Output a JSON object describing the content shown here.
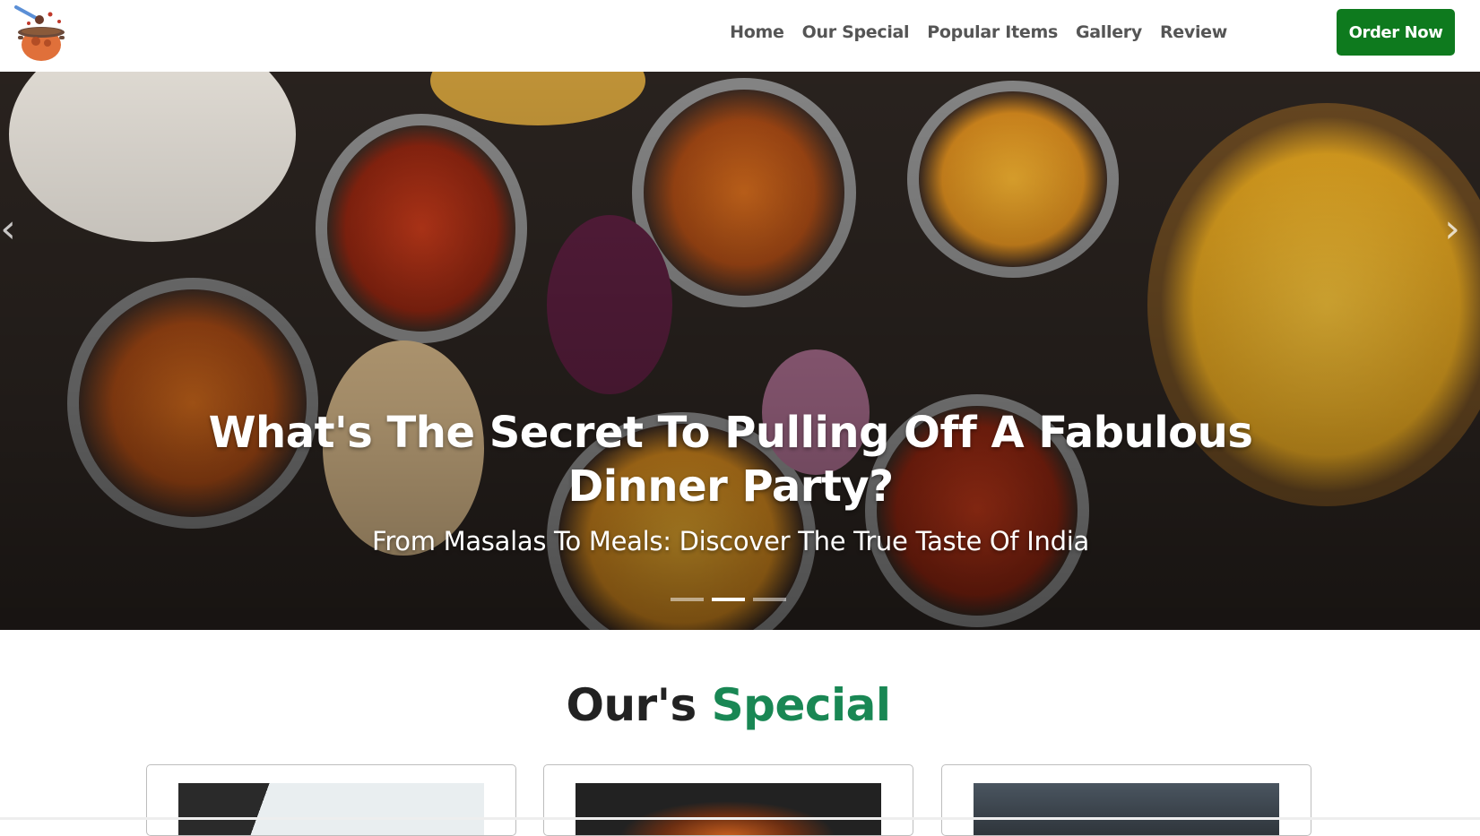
{
  "brand": {
    "logo_icon": "cooking-pot-icon"
  },
  "nav": {
    "links": [
      "Home",
      "Our Special",
      "Popular Items",
      "Gallery",
      "Review"
    ],
    "order_button": "Order Now"
  },
  "hero": {
    "title": "What's The Secret To Pulling Off A Fabulous Dinner Party?",
    "subtitle": "From Masalas To Meals: Discover The True Taste Of India",
    "prev_icon": "chevron-left-icon",
    "next_icon": "chevron-right-icon",
    "slides_total": 3,
    "active_slide": 2
  },
  "section": {
    "title_main": "Our's ",
    "title_accent": "Special"
  },
  "colors": {
    "accent_green": "#198754",
    "button_green": "#0e7a1e",
    "nav_text": "#555555"
  }
}
